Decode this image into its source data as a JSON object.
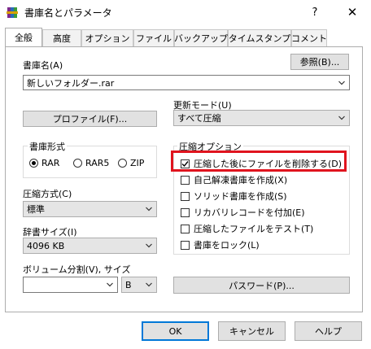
{
  "window": {
    "title": "書庫名とパラメータ",
    "help_symbol": "?",
    "close_symbol": "✕"
  },
  "tabs": [
    {
      "label": "全般",
      "active": true
    },
    {
      "label": "高度"
    },
    {
      "label": "オプション"
    },
    {
      "label": "ファイル"
    },
    {
      "label": "バックアップ"
    },
    {
      "label": "タイムスタンプ"
    },
    {
      "label": "コメント"
    }
  ],
  "archive": {
    "label": "書庫名(A)",
    "browse_button": "参照(B)...",
    "filename": "新しいフォルダー.rar"
  },
  "profile_button": "プロファイル(F)...",
  "update_mode": {
    "label": "更新モード(U)",
    "value": "すべて圧縮"
  },
  "format": {
    "title": "書庫形式",
    "options": [
      {
        "label": "RAR",
        "selected": true
      },
      {
        "label": "RAR5",
        "selected": false
      },
      {
        "label": "ZIP",
        "selected": false
      }
    ]
  },
  "compression": {
    "label": "圧縮方式(C)",
    "value": "標準"
  },
  "dictionary": {
    "label": "辞書サイズ(I)",
    "value": "4096 KB"
  },
  "volume": {
    "label": "ボリューム分割(V), サイズ",
    "value": "",
    "unit": "B"
  },
  "archive_options": {
    "title": "圧縮オプション",
    "items": [
      {
        "label": "圧縮した後にファイルを削除する(D)",
        "checked": true,
        "highlighted": true
      },
      {
        "label": "自己解凍書庫を作成(X)",
        "checked": false
      },
      {
        "label": "ソリッド書庫を作成(S)",
        "checked": false
      },
      {
        "label": "リカバリレコードを付加(E)",
        "checked": false
      },
      {
        "label": "圧縮したファイルをテスト(T)",
        "checked": false
      },
      {
        "label": "書庫をロック(L)",
        "checked": false
      }
    ]
  },
  "password_button": "パスワード(P)...",
  "footer": {
    "ok": "OK",
    "cancel": "キャンセル",
    "help": "ヘルプ"
  },
  "colors": {
    "highlight": "#e0141e",
    "default_button_border": "#0078d7"
  },
  "icons": {
    "app": "winrar-books-icon",
    "dropdown": "chevron-down-icon",
    "checkmark": "check-icon"
  }
}
